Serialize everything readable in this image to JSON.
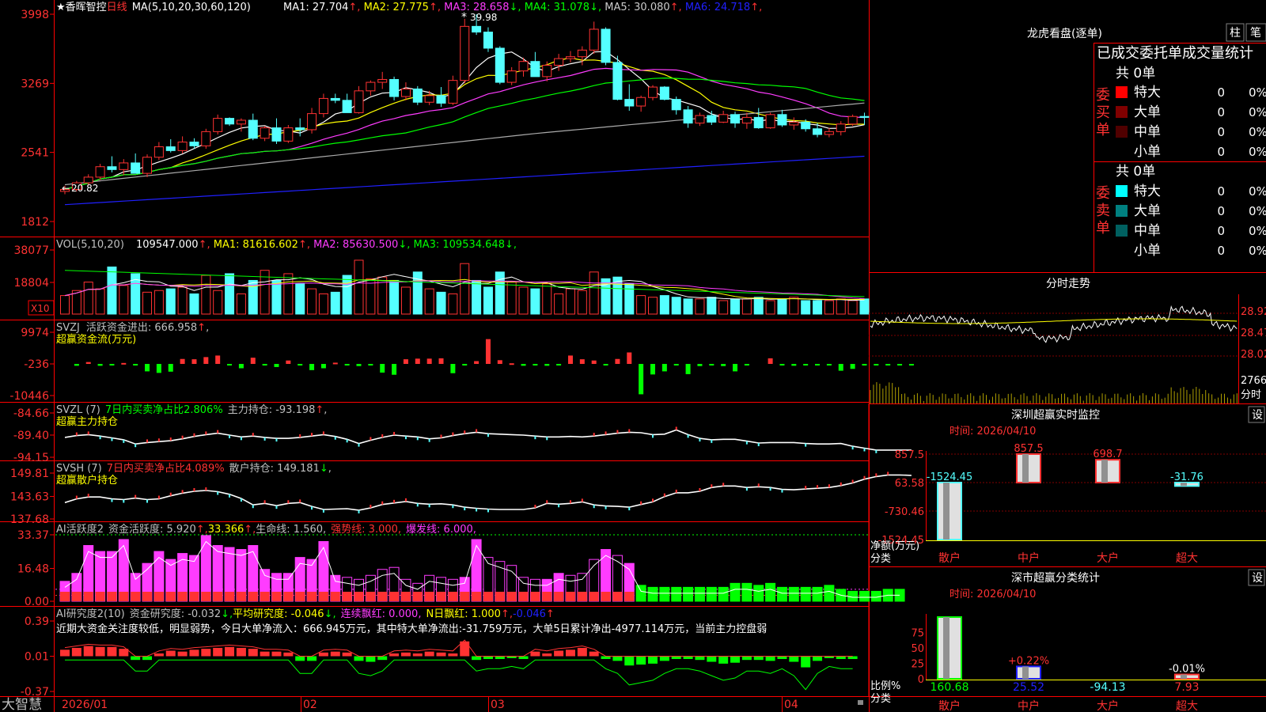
{
  "colors": {
    "up": "#ff3232",
    "down": "#54ffff",
    "white": "#ffffff",
    "yellow": "#ffff00",
    "magenta": "#ff3cff",
    "green": "#00ff00",
    "gray": "#aaaaaa",
    "blue": "#2020ff",
    "frame": "#ff0000",
    "text": "#c0c0c0",
    "darkred": "#800000",
    "darkcyan": "#008080"
  },
  "footer": {
    "brand": "大智慧",
    "dates": [
      "2026/01",
      "02",
      "03",
      "04"
    ]
  },
  "kline": {
    "title_star": "★",
    "name": "香晖智控",
    "period": "日线",
    "ma_list": "MA(5,10,20,30,60,120)",
    "ma_values": [
      {
        "label": "MA1: 27.704",
        "arrow": "↑",
        "color": "#ffffff"
      },
      {
        "label": "MA2: 27.775",
        "arrow": "↑",
        "color": "#ffff00"
      },
      {
        "label": "MA3: 28.658",
        "arrow": "↓",
        "color": "#ff3cff"
      },
      {
        "label": "MA4: 31.078",
        "arrow": "↓",
        "color": "#00ff00"
      },
      {
        "label": "MA5: 30.080",
        "arrow": "↑",
        "color": "#cccccc"
      },
      {
        "label": "MA6: 24.718",
        "arrow": "↑",
        "color": "#2020ff"
      }
    ],
    "axis": [
      "3998",
      "3269",
      "2541",
      "1812"
    ],
    "high_label": "39.98",
    "low_label": "20.82"
  },
  "vol": {
    "title": "VOL(5,10,20)",
    "values": [
      {
        "label": "109547.000",
        "arrow": "↑",
        "color": "#ffffff"
      },
      {
        "label": "MA1: 81616.602",
        "arrow": "↑",
        "color": "#ffff00"
      },
      {
        "label": "MA2: 85630.500",
        "arrow": "↓",
        "color": "#ff3cff"
      },
      {
        "label": "MA3: 109534.648",
        "arrow": "↓",
        "color": "#00ff00"
      }
    ],
    "axis": [
      "38077",
      "18804"
    ],
    "unit": "X10"
  },
  "svzj": {
    "title": "SVZJ",
    "label": "活跃资金进出: 666.958",
    "arrow": "↑",
    "sub": "超赢资金流(万元)",
    "axis": [
      "9974",
      "-236",
      "-10446"
    ]
  },
  "svzl": {
    "title": "SVZL (7)",
    "label1": "7日内买卖净占比2.806%",
    "label2": "主力持仓: -93.198",
    "arrow": "↑",
    "sub": "超赢主力持仓",
    "axis": [
      "-84.66",
      "-89.40",
      "-94.15"
    ]
  },
  "svsh": {
    "title": "SVSH (7)",
    "label1": "7日内买卖净占比4.089%",
    "label2": "散户持仓: 149.181",
    "arrow": "↓",
    "sub": "超赢散户持仓",
    "axis": [
      "149.81",
      "143.63",
      "137.68"
    ]
  },
  "ai2": {
    "title": "AI活跃度2",
    "l1": "资金活跃度: 5.920",
    "l2": "33.366",
    "l3": "生命线: 1.560",
    "l4": "强势线: 3.000",
    "l5": "爆发线: 6.000",
    "axis": [
      "33.37",
      "16.48",
      "0.00"
    ]
  },
  "ai3": {
    "title": "AI研究度2(10)",
    "l1": "资金研究度: -0.032",
    "l2": "平均研究度: -0.046",
    "l3": "连续飘红: 0.000",
    "l4": "N日飘红: 1.000",
    "l5": "-0.046",
    "note": "近期大资金关注度较低，明显弱势，今日大单净流入：666.945万元，其中特大单净流出:-31.759万元，大单5日累计净出-4977.114万元，当前主力控盘弱",
    "axis": [
      "0.39",
      "0.01",
      "-0.37"
    ]
  },
  "side": {
    "title": "龙虎看盘(逐单)",
    "btn1": "柱",
    "btn2": "笔",
    "header": "已成交委托单成交量统计",
    "buy_label": "委买单",
    "sell_label": "委卖单",
    "buy_total": "共 0单",
    "sell_total": "共 0单",
    "buy_rows": [
      {
        "name": "特大",
        "n": "0",
        "p": "0%",
        "c": "#ff0000"
      },
      {
        "name": "大单",
        "n": "0",
        "p": "0%",
        "c": "#800000"
      },
      {
        "name": "中单",
        "n": "0",
        "p": "0%",
        "c": "#500000"
      },
      {
        "name": "小单",
        "n": "0",
        "p": "0%",
        "c": ""
      }
    ],
    "sell_rows": [
      {
        "name": "特大",
        "n": "0",
        "p": "0%",
        "c": "#00ffff"
      },
      {
        "name": "大单",
        "n": "0",
        "p": "0%",
        "c": "#008080"
      },
      {
        "name": "中单",
        "n": "0",
        "p": "0%",
        "c": "#006060"
      },
      {
        "name": "小单",
        "n": "0",
        "p": "0%",
        "c": ""
      }
    ],
    "intraday_title": "分时走势",
    "intraday_axis": [
      "28.92",
      "28.47",
      "28.02",
      "2766",
      "分时"
    ],
    "sz_title": "深圳超赢实时监控",
    "sz_btn": "设",
    "sz_time": "时间: 2026/04/10",
    "sz_axis": [
      "857.5",
      "63.58",
      "-730.46",
      "-1524.45"
    ],
    "sz_ylabel": "净额(万元)",
    "sz_xlabel": "分类",
    "sz_cats": [
      "散户",
      "中户",
      "大户",
      "超大"
    ],
    "sz_vals": [
      "-1524.45",
      "857.5",
      "698.7",
      "-31.76"
    ],
    "cls_title": "深市超赢分类统计",
    "cls_btn": "设",
    "cls_time": "时间: 2026/04/10",
    "cls_axis": [
      "75",
      "50",
      "25",
      "0"
    ],
    "cls_ylabel": "比例%",
    "cls_xlabel": "分类",
    "cls_top": [
      "",
      "+0.22%",
      "",
      "-0.01%"
    ],
    "cls_vals": [
      "160.68",
      "25.52",
      "-94.13",
      "7.93"
    ],
    "cls_cats": [
      "散户",
      "中户",
      "大户",
      "超大"
    ]
  },
  "chart_data": [
    {
      "type": "candlestick",
      "title": "香晖智控 日线",
      "ylim": [
        18.12,
        39.98
      ],
      "ohlc": [
        [
          21.3,
          21.9,
          21.0,
          21.5
        ],
        [
          21.5,
          22.4,
          21.3,
          22.2
        ],
        [
          22.2,
          23.1,
          21.9,
          22.8
        ],
        [
          22.8,
          24.2,
          22.5,
          23.9
        ],
        [
          23.9,
          25.0,
          23.3,
          23.6
        ],
        [
          23.6,
          24.7,
          23.0,
          24.3
        ],
        [
          24.3,
          25.3,
          23.5,
          23.2
        ],
        [
          23.2,
          25.2,
          22.8,
          24.9
        ],
        [
          24.9,
          26.5,
          24.6,
          26.0
        ],
        [
          26.0,
          26.8,
          25.4,
          25.6
        ],
        [
          25.6,
          27.1,
          25.3,
          26.5
        ],
        [
          26.5,
          26.9,
          25.8,
          26.1
        ],
        [
          26.1,
          27.9,
          25.8,
          27.6
        ],
        [
          27.6,
          29.4,
          27.3,
          29.0
        ],
        [
          29.0,
          29.1,
          28.2,
          28.4
        ],
        [
          28.4,
          29.0,
          27.6,
          28.8
        ],
        [
          28.8,
          29.5,
          26.7,
          26.9
        ],
        [
          26.9,
          28.2,
          26.6,
          28.0
        ],
        [
          28.0,
          29.0,
          26.3,
          26.6
        ],
        [
          26.6,
          28.3,
          26.4,
          28.0
        ],
        [
          28.0,
          29.0,
          27.1,
          27.8
        ],
        [
          27.8,
          30.1,
          27.4,
          29.5
        ],
        [
          29.5,
          31.6,
          29.1,
          31.1
        ],
        [
          31.1,
          31.6,
          30.6,
          30.9
        ],
        [
          30.9,
          31.6,
          29.8,
          29.6
        ],
        [
          29.6,
          32.4,
          29.5,
          31.9
        ],
        [
          31.9,
          33.0,
          31.4,
          32.8
        ],
        [
          32.8,
          33.9,
          32.1,
          33.1
        ],
        [
          33.1,
          33.4,
          30.9,
          31.3
        ],
        [
          31.3,
          32.8,
          30.9,
          32.1
        ],
        [
          32.1,
          32.4,
          30.4,
          30.7
        ],
        [
          30.7,
          31.9,
          30.4,
          31.4
        ],
        [
          31.4,
          32.3,
          30.2,
          30.6
        ],
        [
          30.6,
          33.5,
          30.4,
          33.0
        ],
        [
          33.0,
          39.5,
          32.7,
          38.7
        ],
        [
          38.7,
          39.98,
          37.8,
          38.1
        ],
        [
          38.1,
          38.6,
          36.0,
          36.4
        ],
        [
          36.4,
          36.6,
          32.6,
          32.8
        ],
        [
          32.8,
          34.4,
          32.5,
          34.0
        ],
        [
          34.0,
          35.4,
          33.4,
          35.0
        ],
        [
          35.0,
          36.0,
          33.4,
          33.4
        ],
        [
          33.4,
          35.0,
          32.9,
          34.6
        ],
        [
          34.6,
          35.8,
          34.0,
          35.3
        ],
        [
          35.3,
          36.1,
          34.9,
          35.5
        ],
        [
          35.5,
          36.6,
          34.6,
          36.2
        ],
        [
          36.2,
          39.2,
          35.8,
          38.4
        ],
        [
          38.4,
          38.6,
          34.6,
          34.9
        ],
        [
          34.9,
          35.6,
          30.9,
          31.0
        ],
        [
          31.0,
          32.6,
          29.8,
          30.3
        ],
        [
          30.3,
          31.4,
          29.7,
          31.2
        ],
        [
          31.2,
          32.5,
          30.9,
          32.3
        ],
        [
          32.3,
          32.4,
          30.9,
          31.0
        ],
        [
          31.0,
          31.3,
          29.4,
          29.9
        ],
        [
          29.9,
          30.3,
          28.0,
          28.5
        ],
        [
          28.5,
          29.6,
          28.2,
          29.3
        ],
        [
          29.3,
          29.8,
          28.3,
          28.6
        ],
        [
          28.6,
          29.8,
          28.5,
          29.4
        ],
        [
          29.4,
          29.7,
          28.0,
          28.5
        ],
        [
          28.5,
          29.6,
          27.9,
          29.1
        ],
        [
          29.1,
          30.1,
          27.9,
          28.0
        ],
        [
          28.0,
          29.6,
          27.9,
          29.4
        ],
        [
          29.4,
          29.9,
          28.1,
          28.3
        ],
        [
          28.3,
          29.1,
          27.8,
          28.6
        ],
        [
          28.6,
          28.9,
          27.6,
          27.9
        ],
        [
          27.9,
          28.5,
          27.0,
          27.3
        ],
        [
          27.3,
          28.0,
          27.0,
          27.6
        ],
        [
          27.6,
          28.7,
          27.2,
          28.4
        ],
        [
          28.4,
          29.4,
          28.2,
          29.2
        ],
        [
          29.2,
          29.6,
          28.3,
          29.1
        ]
      ]
    },
    {
      "type": "bar",
      "title": "VOL(5,10,20)",
      "ylim": [
        0,
        38077
      ],
      "values": [
        11000,
        14000,
        19000,
        15000,
        28000,
        17000,
        24000,
        13000,
        14000,
        15000,
        16000,
        12000,
        23000,
        14000,
        24000,
        12000,
        20000,
        26000,
        20000,
        24000,
        18000,
        15000,
        12000,
        13000,
        23000,
        32000,
        21000,
        22000,
        20000,
        16000,
        25000,
        15000,
        13000,
        12000,
        30000,
        20000,
        16000,
        25000,
        19000,
        16000,
        15000,
        18000,
        12000,
        15000,
        14000,
        25000,
        21000,
        22000,
        18000,
        11000,
        10000,
        11000,
        10000,
        9000,
        9000,
        10000,
        8000,
        9000,
        9000,
        10000,
        8000,
        9000,
        10000,
        8000,
        8000,
        8000,
        9000,
        8000,
        9000
      ]
    },
    {
      "type": "bar",
      "title": "SVZJ 活跃资金进出",
      "ylim": [
        -10446,
        9974
      ],
      "values": [
        0,
        -600,
        600,
        -600,
        -300,
        300,
        -400,
        -2400,
        -2900,
        -2500,
        1600,
        1500,
        2200,
        2700,
        -400,
        -1400,
        2000,
        -300,
        -1000,
        1100,
        -300,
        -2000,
        -1400,
        400,
        -400,
        -700,
        -500,
        -2800,
        -3500,
        1500,
        1700,
        1700,
        1800,
        -3000,
        -500,
        900,
        8000,
        1200,
        200,
        -600,
        -400,
        -600,
        -300,
        2700,
        1500,
        1100,
        -400,
        1600,
        3700,
        -9800,
        -3400,
        -2400,
        -200,
        -3300,
        -700,
        -400,
        -700,
        -2400,
        -300,
        0,
        1800,
        -500,
        -600,
        -300,
        -400,
        -400,
        -2200,
        -1600,
        -300,
        -300,
        -300,
        -300,
        -300
      ]
    },
    {
      "type": "line",
      "title": "SVZL 主力持仓",
      "ylim": [
        -94.15,
        -84.66
      ],
      "y": [
        -89.9,
        -89.5,
        -89.3,
        -89.6,
        -90.0,
        -90.4,
        -91.3,
        -91.0,
        -90.8,
        -90.6,
        -90.2,
        -89.7,
        -89.3,
        -89.0,
        -89.4,
        -89.8,
        -89.6,
        -89.9,
        -90.1,
        -90.1,
        -89.9,
        -89.6,
        -89.3,
        -89.7,
        -90.3,
        -91.2,
        -90.5,
        -89.9,
        -89.4,
        -89.6,
        -89.8,
        -90.2,
        -90.0,
        -89.5,
        -89.1,
        -88.8,
        -89.1,
        -89.2,
        -89.3,
        -89.4,
        -89.6,
        -89.8,
        -89.8,
        -89.7,
        -89.8,
        -89.6,
        -89.3,
        -89.0,
        -88.8,
        -88.9,
        -89.3,
        -89.2,
        -88.3,
        -89.3,
        -90.1,
        -90.4,
        -90.3,
        -90.3,
        -90.7,
        -91.1,
        -91.0,
        -91.0,
        -91.0,
        -91.2,
        -91.3,
        -91.3,
        -91.2,
        -91.8,
        -92.2,
        -92.6,
        -92.6,
        -92.6,
        -92.6
      ]
    },
    {
      "type": "line",
      "title": "SVSH 散户持仓",
      "ylim": [
        137.68,
        149.81
      ],
      "y": [
        142.0,
        143.0,
        143.5,
        143.5,
        143.0,
        142.8,
        143.2,
        142.8,
        143.0,
        143.8,
        144.5,
        145.0,
        145.2,
        144.9,
        144.2,
        143.1,
        141.4,
        141.8,
        141.2,
        141.8,
        142.0,
        141.0,
        140.2,
        140.3,
        140.4,
        140.0,
        140.6,
        141.5,
        141.9,
        142.3,
        141.8,
        141.6,
        141.7,
        141.4,
        140.8,
        140.5,
        140.3,
        140.2,
        140.2,
        140.2,
        140.6,
        141.8,
        141.6,
        141.8,
        142.2,
        141.4,
        141.1,
        141.0,
        140.8,
        141.5,
        142.2,
        143.6,
        144.6,
        144.6,
        145.0,
        146.0,
        146.4,
        146.4,
        146.0,
        146.2,
        146.0,
        145.5,
        145.4,
        145.6,
        145.8,
        146.0,
        146.5,
        147.2,
        148.2,
        148.9,
        149.3,
        149.3,
        149.2
      ]
    },
    {
      "type": "bar",
      "title": "AI活跃度2",
      "ylim": [
        0,
        33.37
      ],
      "values": [
        10,
        14,
        28,
        25,
        25,
        31,
        14,
        19,
        25,
        21,
        24,
        23,
        33,
        28,
        27,
        26,
        28,
        16,
        14,
        14,
        22,
        21,
        30,
        13,
        12,
        11,
        13,
        16,
        17,
        11,
        9,
        13,
        12,
        11,
        12,
        31,
        22,
        20,
        18,
        12,
        11,
        11,
        14,
        13,
        14,
        21,
        26,
        23,
        19,
        8,
        7,
        7,
        7,
        7,
        7,
        7,
        7,
        9,
        9,
        8,
        9,
        7,
        7,
        7,
        7,
        8,
        6,
        5,
        5,
        5,
        6,
        6
      ]
    },
    {
      "type": "bar",
      "title": "AI研究度2(10)",
      "ylim": [
        -0.37,
        0.39
      ],
      "values": [
        0.07,
        0.09,
        0.11,
        0.1,
        0.1,
        0.08,
        -0.04,
        -0.04,
        0.03,
        0.06,
        0.05,
        0.07,
        0.08,
        0.09,
        0.1,
        0.09,
        0.08,
        0.05,
        0.05,
        0.04,
        -0.05,
        -0.05,
        0.04,
        0.05,
        0.04,
        -0.05,
        -0.06,
        -0.04,
        0.03,
        0.04,
        0.03,
        0.05,
        0.04,
        0.03,
        0.16,
        -0.04,
        -0.03,
        -0.03,
        -0.02,
        -0.03,
        0.05,
        0.03,
        0.06,
        0.07,
        0.09,
        0.05,
        -0.03,
        -0.05,
        -0.1,
        -0.09,
        -0.08,
        -0.05,
        -0.03,
        -0.03,
        -0.04,
        -0.06,
        -0.08,
        -0.07,
        -0.04,
        -0.04,
        -0.05,
        -0.03,
        -0.06,
        -0.12,
        -0.05,
        -0.02,
        -0.03,
        -0.03
      ]
    }
  ]
}
